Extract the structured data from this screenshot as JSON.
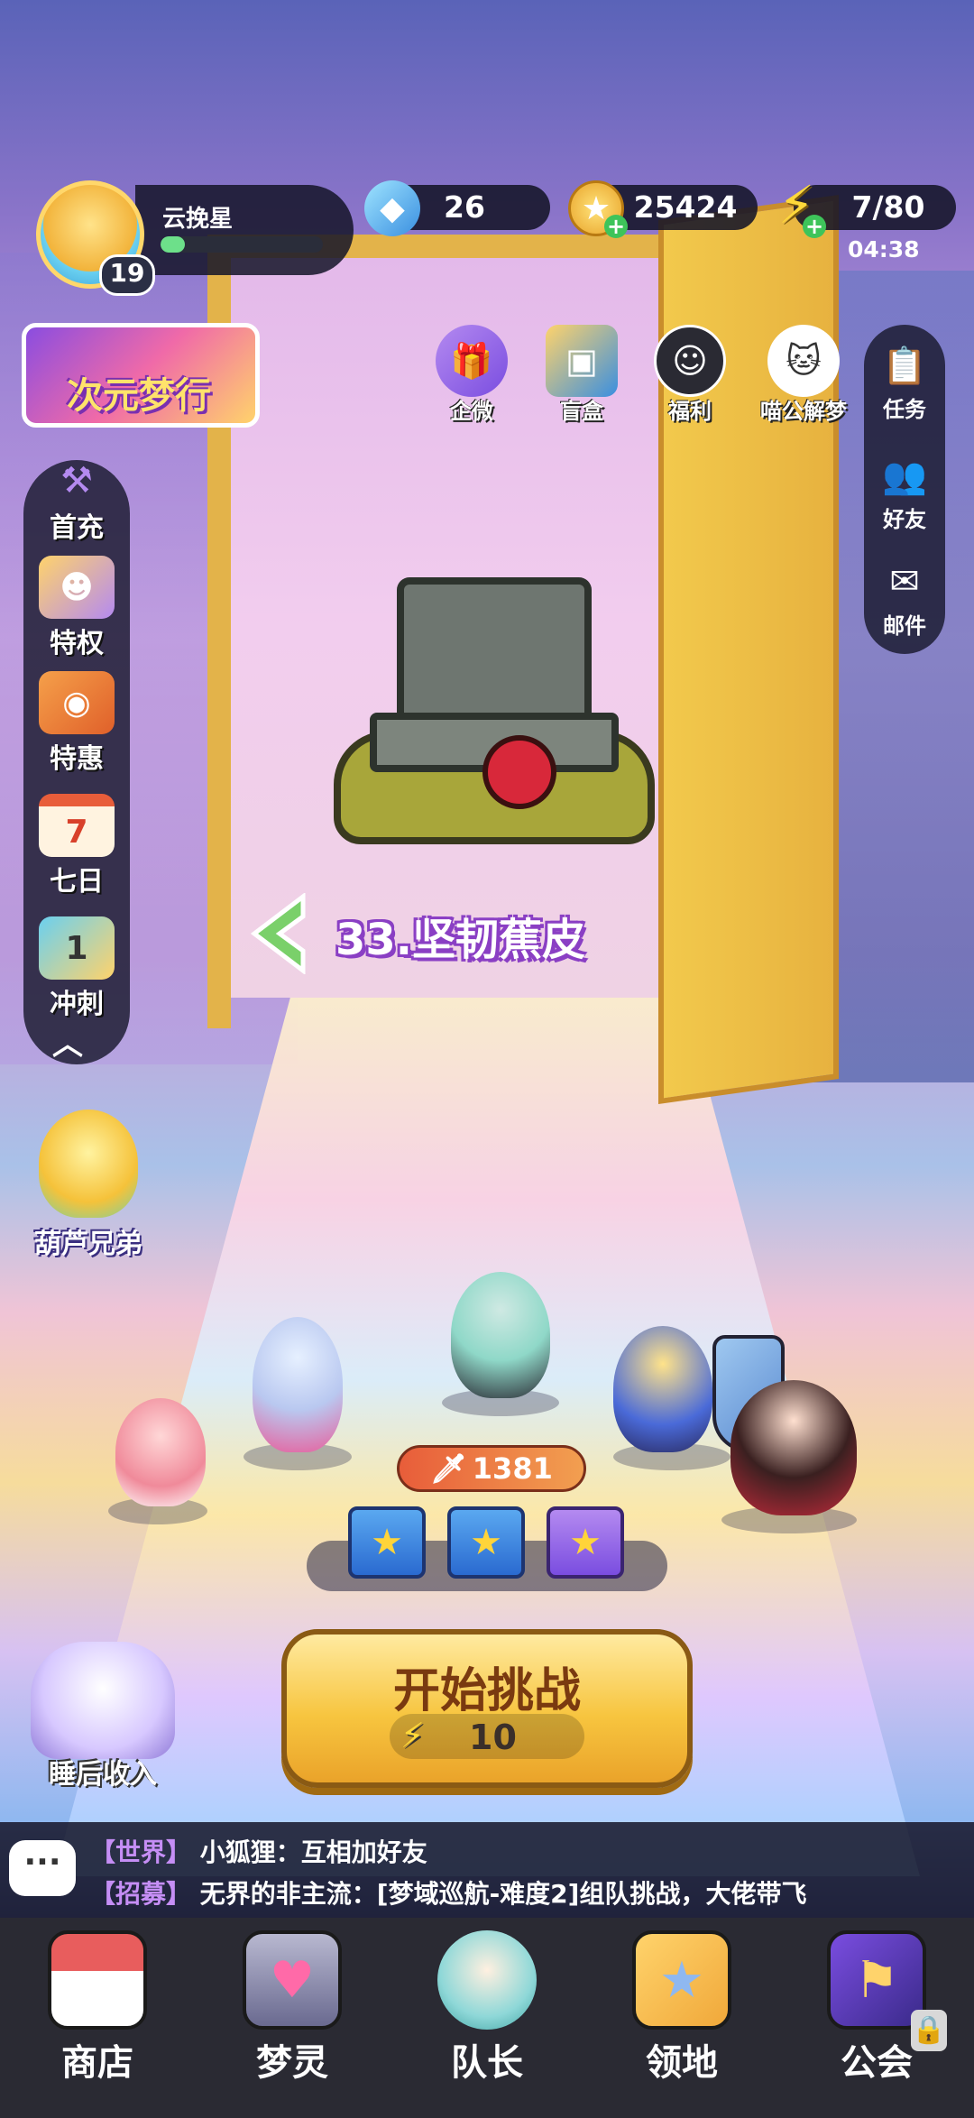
{
  "player": {
    "name": "云挽星",
    "level": "19",
    "exp_fraction": 0.15
  },
  "resources": {
    "gems": "26",
    "gold": "25424",
    "energy": "7/80",
    "energy_timer": "04:38"
  },
  "event_banner": {
    "label": "次元梦行"
  },
  "top_icons": [
    {
      "label": "企微",
      "icon": "gift-icon"
    },
    {
      "label": "盲盒",
      "icon": "card-box-icon"
    },
    {
      "label": "福利",
      "icon": "welfare-mask-icon"
    },
    {
      "label": "喵公解梦",
      "icon": "cat-icon"
    }
  ],
  "right_sidebar": [
    {
      "label": "任务",
      "icon": "task-notepad-icon"
    },
    {
      "label": "好友",
      "icon": "friends-icon"
    },
    {
      "label": "邮件",
      "icon": "mail-icon"
    }
  ],
  "left_sidebar": [
    {
      "label": "首充",
      "icon": "axe-icon"
    },
    {
      "label": "特权",
      "icon": "privilege-cards-icon"
    },
    {
      "label": "特惠",
      "icon": "discount-box-icon"
    },
    {
      "label": "七日",
      "icon": "calendar-7-icon",
      "badge": "7"
    },
    {
      "label": "冲刺",
      "icon": "sprint-flag-icon",
      "badge": "1"
    }
  ],
  "side_events": {
    "gourd": "葫芦兄弟",
    "sleep_income": "睡后收入"
  },
  "stage": {
    "title": "33.坚韧蕉皮"
  },
  "team": {
    "power": "1381"
  },
  "start_button": {
    "label": "开始挑战",
    "cost": "10"
  },
  "chat": [
    {
      "channel": "【世界】",
      "text": "小狐狸：互相加好友"
    },
    {
      "channel": "【招募】",
      "text": "无界的非主流：[梦域巡航-难度2]组队挑战，大佬带飞"
    }
  ],
  "bottom_nav": [
    {
      "label": "商店",
      "icon": "shop-icon"
    },
    {
      "label": "梦灵",
      "icon": "spirit-machine-icon"
    },
    {
      "label": "队长",
      "icon": "captain-avatar-icon"
    },
    {
      "label": "领地",
      "icon": "territory-door-icon"
    },
    {
      "label": "公会",
      "icon": "guild-icon",
      "locked": true
    }
  ],
  "colors": {
    "accent_gold": "#f7c53f",
    "chat_channel": "#c58ef5",
    "exp_green": "#6de08a",
    "nav_bg": "#2a2a33"
  }
}
